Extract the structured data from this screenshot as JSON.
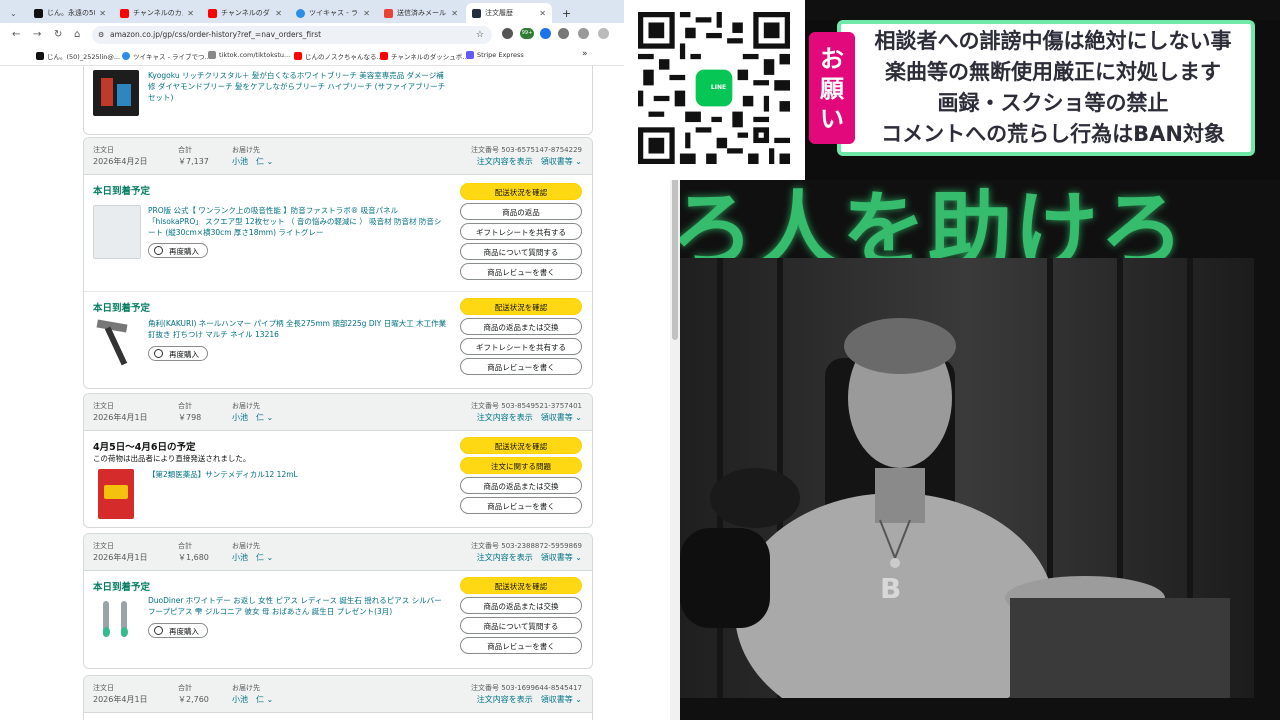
{
  "browser": {
    "tabs": [
      {
        "label": "じん。永遠の58で"
      },
      {
        "label": "チャンネルのカスタ"
      },
      {
        "label": "チャンネルのダッシ"
      },
      {
        "label": "ツイキャス - ライブ"
      },
      {
        "label": "送信済みメール -"
      },
      {
        "label": "注文履歴"
      }
    ],
    "new_tab": "+",
    "url": "amazon.co.jp/gp/css/order-history?ref_=nav_orders_first",
    "extension_badge": "99+",
    "bookmarks": [
      {
        "label": "じん。(50)_2525lin@..."
      },
      {
        "label": "ツイキャス - ライブでつ..."
      },
      {
        "label": "tiktok.com/tiktokstu..."
      },
      {
        "label": "じんのノスクちゃんなる..."
      },
      {
        "label": "チャンネルのダッシュボ..."
      },
      {
        "label": "Stripe Express"
      }
    ],
    "bookmarks_more": "»"
  },
  "orders_header_labels": {
    "order_date": "注文日",
    "total": "合計",
    "ship_to": "お届け先",
    "order_no_prefix": "注文番号",
    "details": "注文内容を表示",
    "receipt": "領収書等"
  },
  "top_item": {
    "title": "Kyogoku リッチクリスタル＋ 髪が白くなるホワイトブリーチ 美容室専売品 ダメージ補修 ダイヤモンドブリーチ 髪をケアしながらブリーチ ハイブリーチ (サファイアブリーチセット)"
  },
  "orders": [
    {
      "date": "2026年4月2日",
      "total": "￥7,137",
      "ship_to": "小池　仁",
      "order_no": "503-6575147-8754229",
      "items": [
        {
          "status": "本日到着予定",
          "title": "PRO版 公式【 ワンランク上の吸音性能 】防音ファストラボ® 吸音パネル「hisokaPRO」 スクエア型 12枚セット （ 音の悩みの軽減に ） 吸音材 防音材 防音シート (縦30cm×横30cm 厚さ18mm) ライトグレー",
          "rebuy": "再度購入",
          "buttons": [
            "配送状況を確認",
            "商品の返品",
            "ギフトレシートを共有する",
            "商品について質問する",
            "商品レビューを書く"
          ]
        },
        {
          "status": "本日到着予定",
          "title": "角利(KAKURI) ネールハンマー パイプ柄 全長275mm 頭部225g DIY 日曜大工 木工作業 釘抜き 打ちつけ マルチ ネイル 13216",
          "rebuy": "再度購入",
          "buttons": [
            "配送状況を確認",
            "商品の返品または交換",
            "ギフトレシートを共有する",
            "商品レビューを書く"
          ]
        }
      ]
    },
    {
      "date": "2026年4月1日",
      "total": "￥798",
      "ship_to": "小池　仁",
      "order_no": "503-8549521-3757401",
      "items": [
        {
          "status": "4月5日～4月6日の予定",
          "note": "この荷物は出品者により直接発送されました。",
          "title": "【第2類医薬品】サンテメディカル12 12mL",
          "buttons": [
            "配送状況を確認",
            "注文に関する問題",
            "商品の返品または交換",
            "商品レビューを書く"
          ]
        }
      ]
    },
    {
      "date": "2026年4月1日",
      "total": "￥1,680",
      "ship_to": "小池　仁",
      "order_no": "503-2388872-5959869",
      "items": [
        {
          "status": "本日到着予定",
          "title": "DuoDiner ホワイトデー お返し 女性 ピアス レディース 誕生石 揺れるピアス シルバー フープピアス 雫 ジルコニア 彼女 母 おばあさん 誕生日 プレゼント(3月)",
          "rebuy": "再度購入",
          "buttons": [
            "配送状況を確認",
            "商品の返品または交換",
            "商品について質問する",
            "商品レビューを書く"
          ]
        }
      ]
    },
    {
      "date": "2026年4月1日",
      "total": "￥2,760",
      "ship_to": "小池　仁",
      "order_no": "503-1699644-8545417"
    }
  ],
  "qr_badge": "LINE",
  "stream": {
    "neon_sign": "ろ人を助けろ",
    "notice_tag": "お願い",
    "notice_lines": [
      "相談者への誹謗中傷は絶対にしない事",
      "楽曲等の無断使用厳正に対処します",
      "画録・スクショ等の禁止",
      "コメントへの荒らし行為はBAN対象"
    ]
  },
  "colors": {
    "amazon_yellow": "#ffd814",
    "link_teal": "#007185",
    "delivery_green": "#067d62",
    "notice_pink": "#e2097c",
    "notice_border": "#6fe8a8"
  }
}
